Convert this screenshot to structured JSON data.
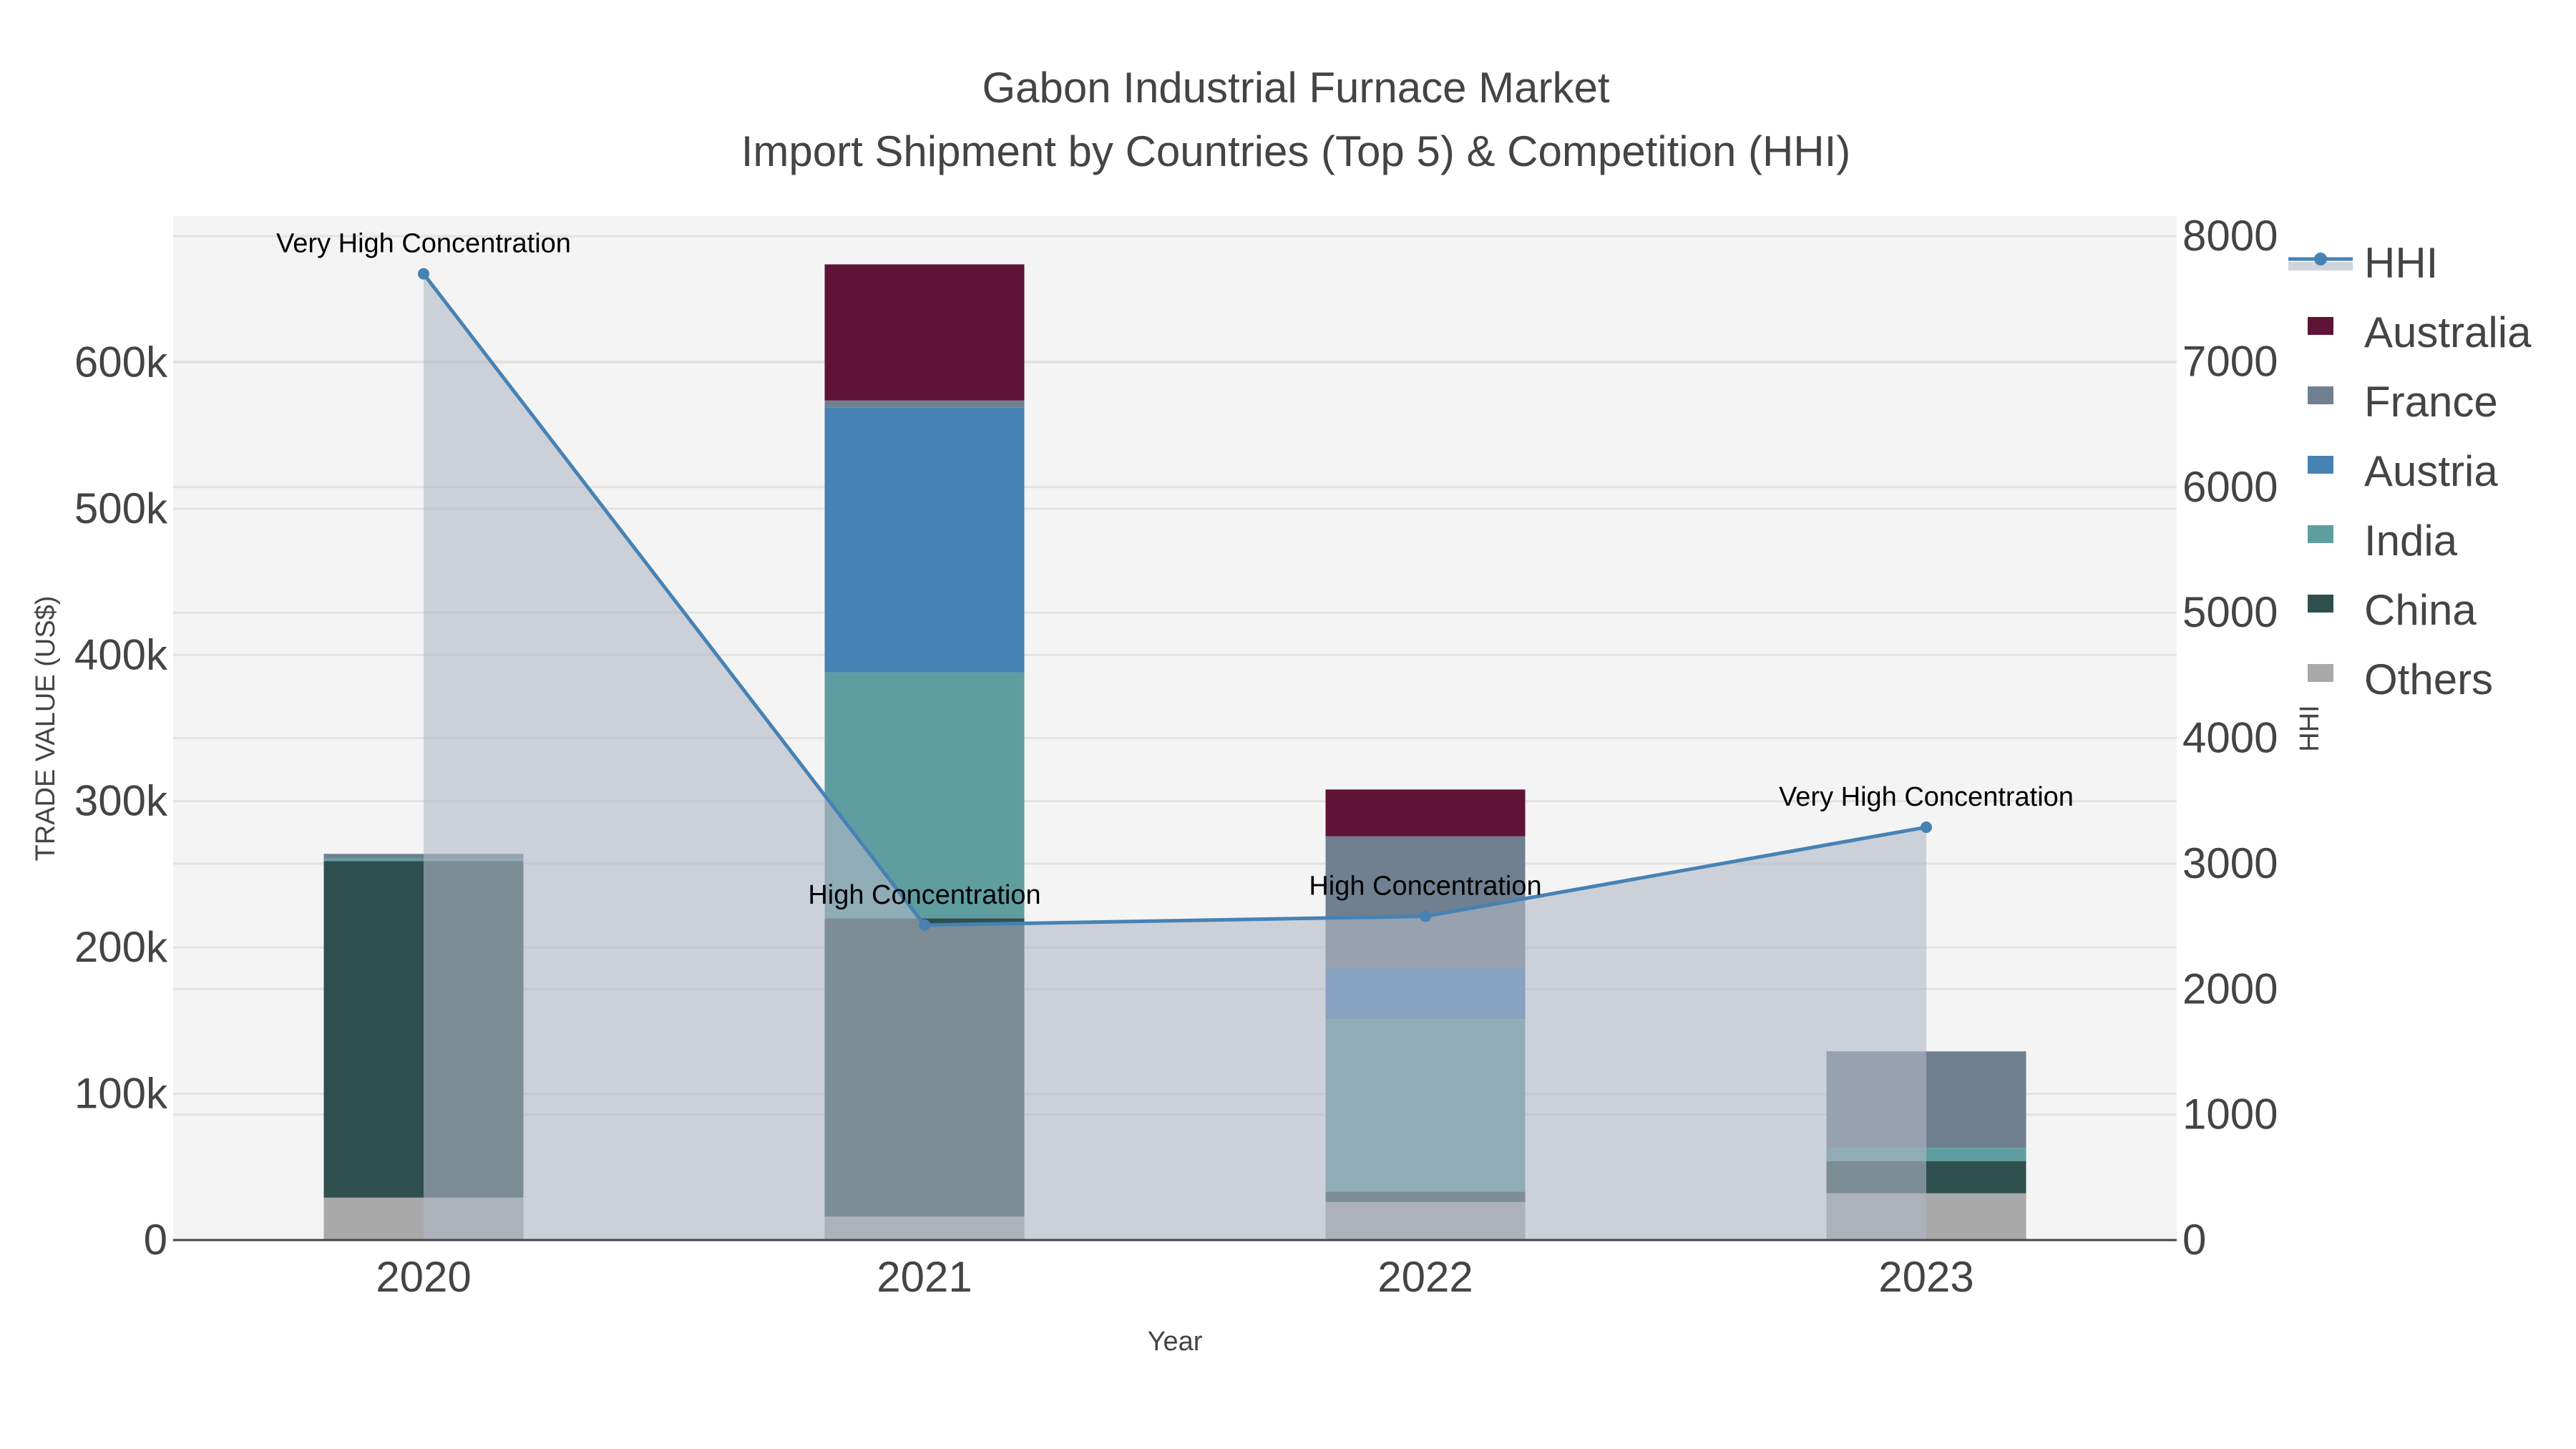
{
  "chart_data": {
    "type": "bar",
    "barmode": "stack",
    "title": "Gabon Industrial Furnace Market",
    "subtitle": "Import Shipment by Countries (Top 5) & Competition (HHI)",
    "xlabel": "Year",
    "ylabel": "TRADE VALUE (US$)",
    "y2label": "HHI",
    "categories": [
      "2020",
      "2021",
      "2022",
      "2023"
    ],
    "ylim": [
      0,
      700000
    ],
    "y2lim": [
      0,
      8160
    ],
    "yticks": [
      0,
      100000,
      200000,
      300000,
      400000,
      500000,
      600000
    ],
    "ytick_labels": [
      "0",
      "100k",
      "200k",
      "300k",
      "400k",
      "500k",
      "600k"
    ],
    "y2ticks": [
      0,
      1000,
      2000,
      3000,
      4000,
      5000,
      6000,
      7000,
      8000
    ],
    "y2tick_labels": [
      "0",
      "1000",
      "2000",
      "3000",
      "4000",
      "5000",
      "6000",
      "7000",
      "8000"
    ],
    "grid": true,
    "legend_position": "right",
    "series": [
      {
        "name": "Others",
        "color": "#a9a9a9",
        "values": [
          29000,
          16000,
          26000,
          32000
        ]
      },
      {
        "name": "China",
        "color": "#2f4f4f",
        "values": [
          230000,
          204000,
          7000,
          22000
        ]
      },
      {
        "name": "India",
        "color": "#5f9ea0",
        "values": [
          2000,
          168000,
          118000,
          9000
        ]
      },
      {
        "name": "Austria",
        "color": "#4682b4",
        "values": [
          0,
          181000,
          35000,
          0
        ]
      },
      {
        "name": "France",
        "color": "#708090",
        "values": [
          3000,
          5000,
          90000,
          66000
        ]
      },
      {
        "name": "Australia",
        "color": "#5f1336",
        "values": [
          0,
          93000,
          32000,
          0
        ]
      }
    ],
    "hhi": {
      "name": "HHI",
      "color": "#4682b4",
      "values": [
        7700,
        2510,
        2580,
        3290
      ],
      "annotations": [
        "Very High Concentration",
        "High Concentration",
        "High Concentration",
        "Very High Concentration"
      ]
    },
    "legend_order": [
      "HHI",
      "Australia",
      "France",
      "Austria",
      "India",
      "China",
      "Others"
    ]
  }
}
